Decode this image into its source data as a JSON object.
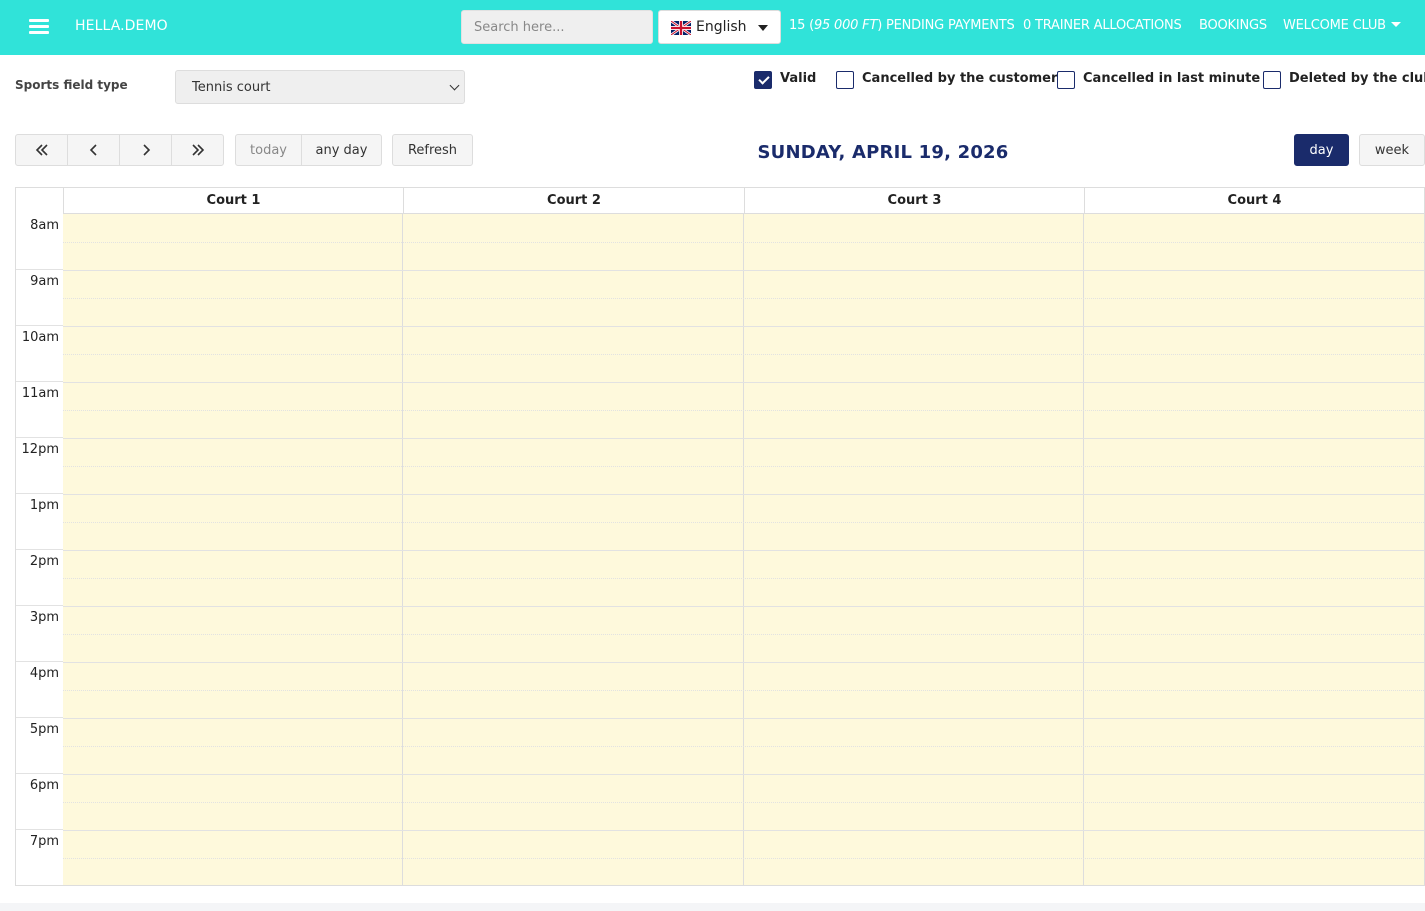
{
  "navbar": {
    "brand": "HELLA.DEMO",
    "search_placeholder": "Search here...",
    "language": "English",
    "pending_count": "15 (",
    "pending_amount": "95 000 FT",
    "pending_suffix": ") PENDING PAYMENTS",
    "trainer_allocations": "0 TRAINER ALLOCATIONS",
    "bookings": "BOOKINGS",
    "welcome": "WELCOME CLUB"
  },
  "filters": {
    "field_type_label": "Sports field type",
    "field_type_value": "Tennis court",
    "checkboxes": [
      {
        "label": "Valid",
        "checked": true
      },
      {
        "label": "Cancelled by the customer",
        "checked": false
      },
      {
        "label": "Cancelled in last minute",
        "checked": false
      },
      {
        "label": "Deleted by the club",
        "checked": false
      }
    ]
  },
  "calendar": {
    "today_label": "today",
    "anyday_label": "any day",
    "refresh_label": "Refresh",
    "title": "SUNDAY, APRIL 19, 2026",
    "view_day": "day",
    "view_week": "week",
    "active_view": "day",
    "columns": [
      "Court 1",
      "Court 2",
      "Court 3",
      "Court 4"
    ],
    "hours": [
      "8am",
      "9am",
      "10am",
      "11am",
      "12pm",
      "1pm",
      "2pm",
      "3pm",
      "4pm",
      "5pm",
      "6pm",
      "7pm"
    ]
  },
  "colors": {
    "navbar": "#30e3d9",
    "accent": "#1a2b6b",
    "slot_background": "#fef9dc"
  },
  "icons": [
    "menu-icon",
    "uk-flag-icon",
    "caret-down-icon",
    "double-chevron-left-icon",
    "chevron-left-icon",
    "chevron-right-icon",
    "double-chevron-right-icon",
    "check-icon"
  ]
}
